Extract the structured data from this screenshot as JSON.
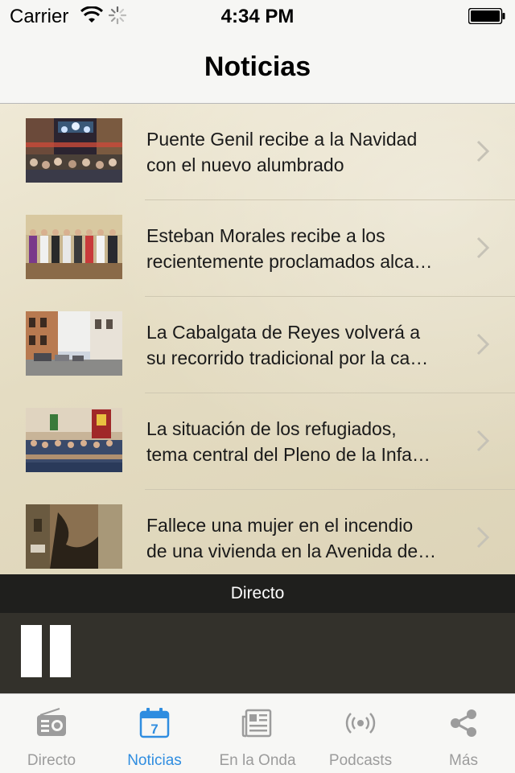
{
  "status_bar": {
    "carrier": "Carrier",
    "time": "4:34 PM",
    "icons": [
      "wifi-icon",
      "activity-spinner-icon",
      "battery-icon"
    ]
  },
  "nav_bar": {
    "title": "Noticias"
  },
  "news": [
    {
      "line1": "Puente Genil recibe a la Navidad",
      "line2": "con el nuevo alumbrado"
    },
    {
      "line1": "Esteban Morales recibe a los",
      "line2": "recientemente proclamados alca…"
    },
    {
      "line1": "La Cabalgata de Reyes volverá a",
      "line2": "su recorrido tradicional por la ca…"
    },
    {
      "line1": "La situación de los refugiados,",
      "line2": "tema central del Pleno de la Infa…"
    },
    {
      "line1": "Fallece una mujer en el incendio",
      "line2": "de una vivienda en la Avenida de…"
    }
  ],
  "player": {
    "label": "Directo",
    "state_icon": "pause-icon"
  },
  "tabs": [
    {
      "label": "Directo",
      "icon": "radio-icon",
      "active": false
    },
    {
      "label": "Noticias",
      "icon": "calendar-icon",
      "active": true
    },
    {
      "label": "En la Onda",
      "icon": "newspaper-icon",
      "active": false
    },
    {
      "label": "Podcasts",
      "icon": "broadcast-icon",
      "active": false
    },
    {
      "label": "Más",
      "icon": "share-icon",
      "active": false
    }
  ],
  "colors": {
    "accent": "#2f8de0",
    "tab_inactive": "#9c9c9c",
    "player_header": "#1f1f1d",
    "player_body": "#33312b"
  }
}
